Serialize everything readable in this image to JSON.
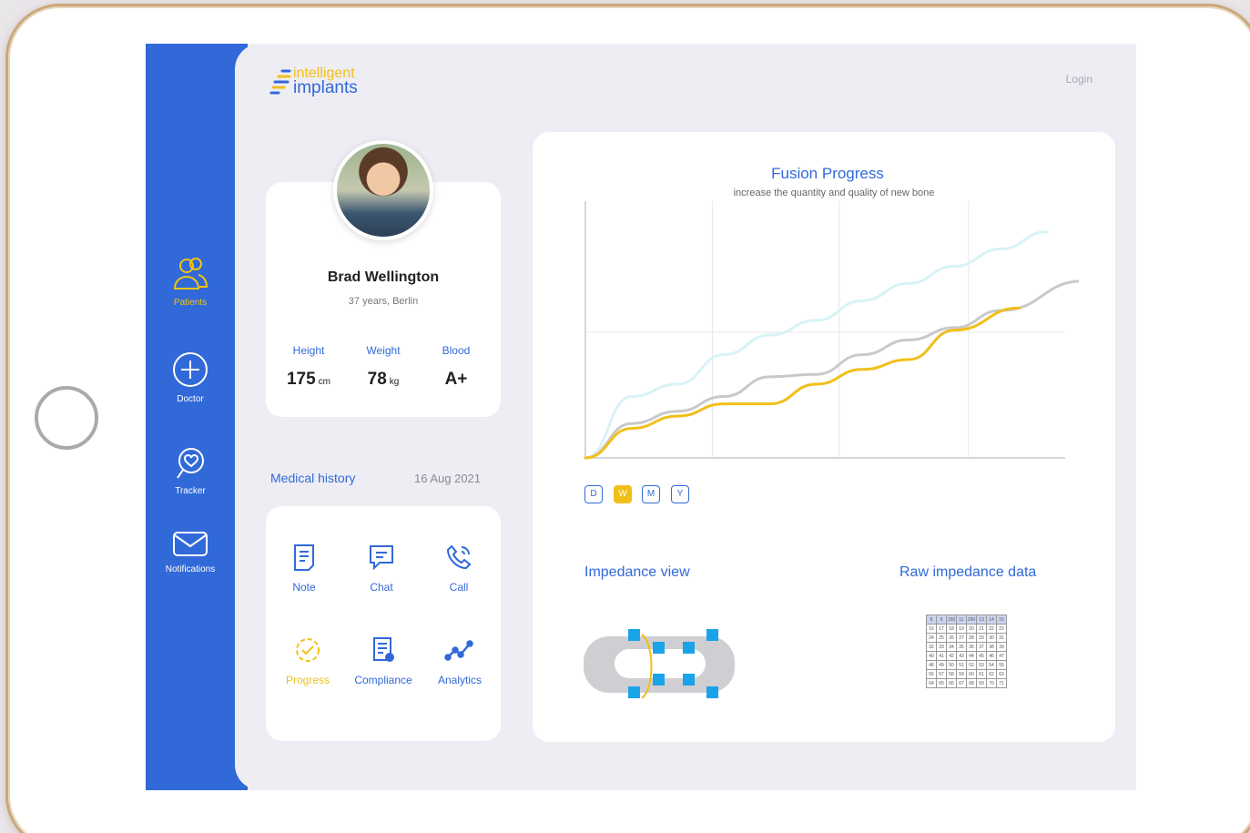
{
  "brand": {
    "line1": "intelligent",
    "line2": "implants"
  },
  "header": {
    "login": "Login"
  },
  "sidebar": {
    "items": [
      {
        "label": "Patients",
        "icon": "users-icon",
        "active": true
      },
      {
        "label": "Doctor",
        "icon": "plus-circle-icon",
        "active": false
      },
      {
        "label": "Tracker",
        "icon": "heart-search-icon",
        "active": false
      },
      {
        "label": "Notifications",
        "icon": "envelope-icon",
        "active": false
      }
    ]
  },
  "patient": {
    "name": "Brad Wellington",
    "meta": "37 years, Berlin",
    "stats": [
      {
        "label": "Height",
        "value": "175",
        "unit": "cm"
      },
      {
        "label": "Weight",
        "value": "78",
        "unit": "kg"
      },
      {
        "label": "Blood",
        "value": "A+",
        "unit": ""
      }
    ]
  },
  "medical_history": {
    "title": "Medical history",
    "date": "16 Aug 2021"
  },
  "actions": [
    {
      "label": "Note",
      "icon": "note-icon",
      "highlight": false
    },
    {
      "label": "Chat",
      "icon": "chat-icon",
      "highlight": false
    },
    {
      "label": "Call",
      "icon": "call-icon",
      "highlight": false
    },
    {
      "label": "Progress",
      "icon": "progress-icon",
      "highlight": true
    },
    {
      "label": "Compliance",
      "icon": "compliance-icon",
      "highlight": false
    },
    {
      "label": "Analytics",
      "icon": "analytics-icon",
      "highlight": false
    }
  ],
  "fusion": {
    "title": "Fusion Progress",
    "subtitle": "increase the quantity and quality of new bone",
    "ranges": [
      "D",
      "W",
      "M",
      "Y"
    ],
    "selected_range": "W"
  },
  "chart_data": {
    "type": "line",
    "title": "Fusion Progress",
    "subtitle": "increase the quantity and quality of new bone",
    "x": [
      0,
      1,
      2,
      3,
      4,
      5,
      6,
      7,
      8,
      9,
      10
    ],
    "xlim": [
      0,
      10
    ],
    "ylim": [
      0,
      100
    ],
    "grid": true,
    "series": [
      {
        "color": "#d7f3f6",
        "values": [
          0,
          25,
          30,
          42,
          50,
          56,
          64,
          71,
          78,
          85,
          92
        ],
        "x": [
          0,
          1,
          2,
          3,
          4,
          5,
          6,
          7,
          8,
          9,
          10
        ]
      },
      {
        "color": "#c9c9cc",
        "values": [
          0,
          14,
          19,
          25,
          33,
          34,
          42,
          48,
          53,
          60,
          72
        ],
        "x": [
          0,
          1,
          2,
          3,
          4,
          5,
          6,
          7,
          8,
          9,
          10.8
        ]
      },
      {
        "color": "#f1bf1a",
        "values": [
          0,
          12,
          17,
          22,
          22,
          30,
          36,
          40,
          52,
          61
        ],
        "x": [
          0,
          1,
          2,
          3,
          4,
          5,
          6,
          7,
          8,
          9.4
        ]
      }
    ]
  },
  "impedance": {
    "view_title": "Impedance view",
    "raw_title": "Raw impedance data"
  },
  "raw_table": [
    [
      "8",
      "9",
      "150",
      "11",
      "200",
      "13",
      "14",
      "15"
    ],
    [
      "16",
      "17",
      "18",
      "19",
      "20",
      "21",
      "22",
      "23"
    ],
    [
      "24",
      "25",
      "26",
      "27",
      "28",
      "29",
      "30",
      "31"
    ],
    [
      "32",
      "33",
      "34",
      "35",
      "36",
      "37",
      "38",
      "39"
    ],
    [
      "40",
      "41",
      "42",
      "43",
      "44",
      "45",
      "46",
      "47"
    ],
    [
      "48",
      "49",
      "50",
      "51",
      "52",
      "53",
      "54",
      "55"
    ],
    [
      "56",
      "57",
      "58",
      "59",
      "60",
      "61",
      "62",
      "63"
    ],
    [
      "64",
      "65",
      "66",
      "67",
      "68",
      "69",
      "70",
      "71"
    ]
  ],
  "colors": {
    "brand_blue": "#3169d8",
    "accent_yellow": "#f1bf1a"
  }
}
